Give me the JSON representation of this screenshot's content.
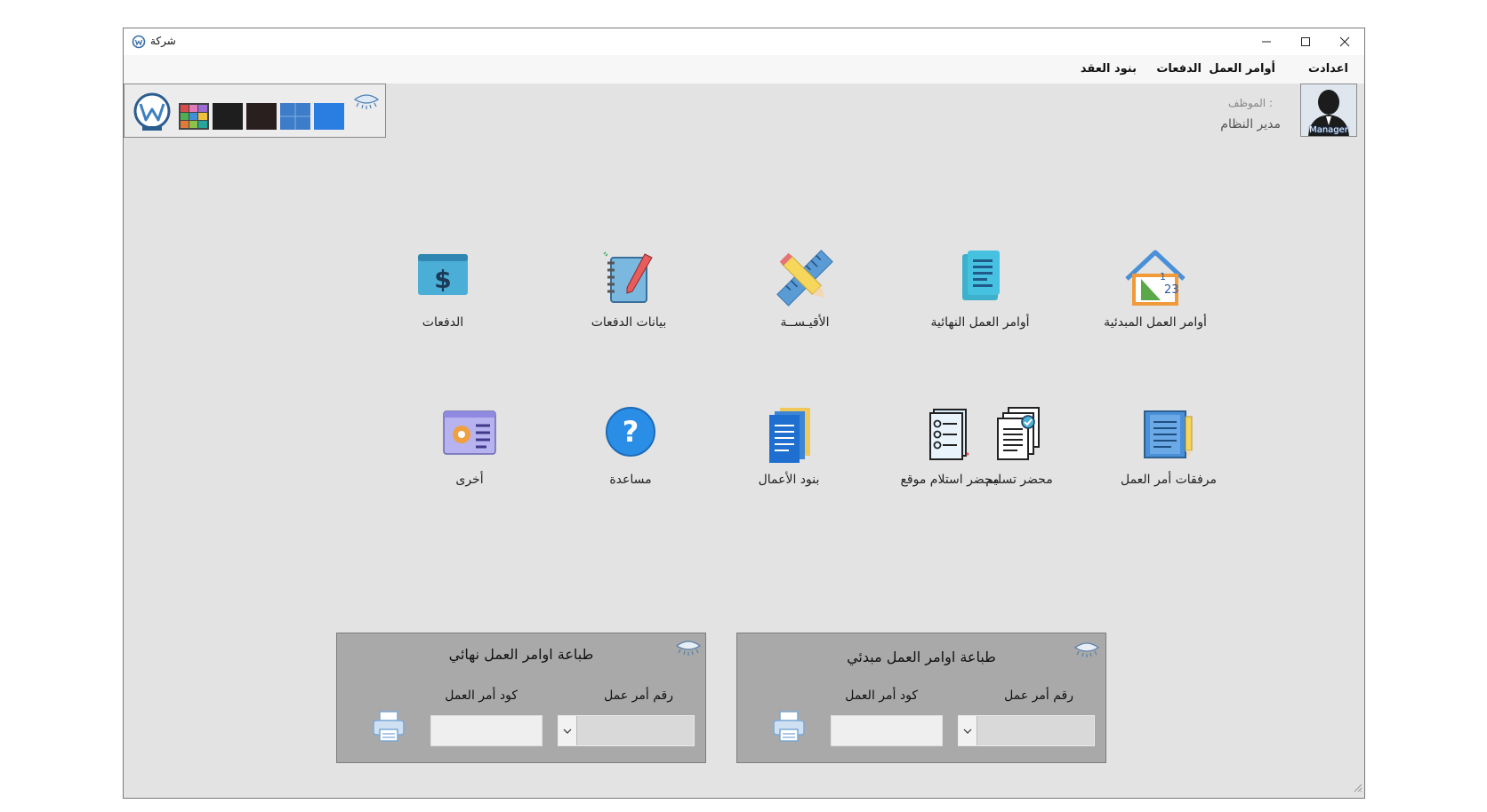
{
  "window": {
    "title": "شركة"
  },
  "menu": {
    "items": [
      "اعدادت",
      "أوامر العمل",
      "الدفعات",
      "بنود العقد"
    ]
  },
  "theme": {
    "swatches": [
      "multicolor",
      "#1e1e1e",
      "#2a1f1f",
      "#3d7cc8",
      "#2a7de1"
    ]
  },
  "user": {
    "label": ": الموظف",
    "name": "مدير النظام",
    "avatar_caption": "Manager"
  },
  "tiles_row1": [
    {
      "label": "أوامر العمل المبدئية",
      "icon": "house-math-icon"
    },
    {
      "label": "أوامر العمل النهائية",
      "icon": "document-list-icon"
    },
    {
      "label": "الأقيـســة",
      "icon": "ruler-pencil-icon"
    },
    {
      "label": "بيانات الدفعات",
      "icon": "notebook-icon"
    },
    {
      "label": "الدفعات",
      "icon": "dollar-icon"
    }
  ],
  "tiles_row2": [
    {
      "label": "مرفقات أمر العمل",
      "icon": "notebook-pencil-icon"
    },
    {
      "label": "محضر تسليم",
      "icon": "documents-check-icon"
    },
    {
      "label": "محضر استلام موقع",
      "icon": "checklist-icon"
    },
    {
      "label": "بنود الأعمال",
      "icon": "blue-documents-icon"
    },
    {
      "label": "مساعدة",
      "icon": "help-icon"
    },
    {
      "label": "أخرى",
      "icon": "settings-window-icon"
    }
  ],
  "print_initial": {
    "title": "طباعة اوامر العمل مبدئي",
    "order_number_label": "رقم أمر عمل",
    "order_code_label": "كود أمر العمل",
    "order_number_value": "",
    "order_code_value": ""
  },
  "print_final": {
    "title": "طباعة اوامر العمل نهائي",
    "order_number_label": "رقم أمر عمل",
    "order_code_label": "كود أمر العمل",
    "order_number_value": "",
    "order_code_value": ""
  }
}
